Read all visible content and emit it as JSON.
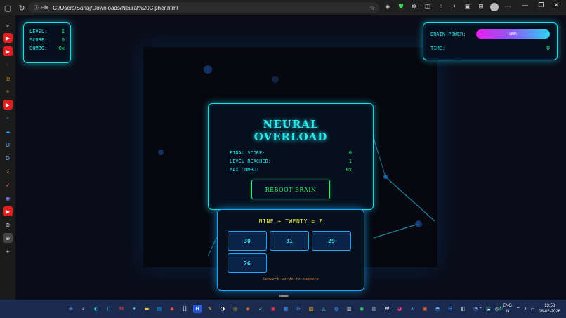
{
  "browser": {
    "file_label": "File",
    "url": "C:/Users/Sahaj/Downloads/Neural%20Cipher.html"
  },
  "game": {
    "stats": {
      "level_label": "LEVEL:",
      "level_value": "1",
      "score_label": "SCORE:",
      "score_value": "0",
      "combo_label": "COMBO:",
      "combo_value": "0x"
    },
    "power": {
      "brain_power_label": "BRAIN POWER:",
      "brain_power_value": "100%",
      "brain_power_fraction": 1.0,
      "time_label": "TIME:",
      "time_value": "0"
    },
    "overload": {
      "title": "NEURAL OVERLOAD",
      "final_score_label": "FINAL SCORE:",
      "final_score_value": "0",
      "level_reached_label": "LEVEL REACHED:",
      "level_reached_value": "1",
      "max_combo_label": "MAX COMBO:",
      "max_combo_value": "0x",
      "reboot_label": "REBOOT BRAIN"
    },
    "quiz": {
      "question": "NINE + TWENTY = ?",
      "answers": [
        "30",
        "31",
        "29",
        "26"
      ],
      "hint": "Convert words to numbers"
    }
  },
  "taskbar": {
    "lang_top": "ENG",
    "lang_bottom": "IN",
    "time": "13:58",
    "date": "08-02-2026"
  },
  "colors": {
    "accent_cyan": "#21d9e8",
    "accent_green": "#2ef56b",
    "question_yellow": "#eef250",
    "hint_orange": "#e7822b"
  }
}
